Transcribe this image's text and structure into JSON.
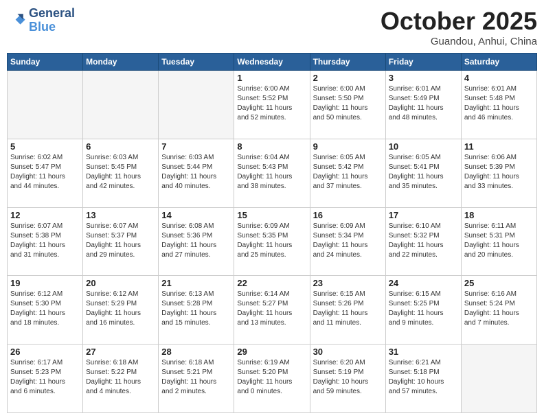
{
  "header": {
    "logo_general": "General",
    "logo_blue": "Blue",
    "month": "October 2025",
    "location": "Guandou, Anhui, China"
  },
  "weekdays": [
    "Sunday",
    "Monday",
    "Tuesday",
    "Wednesday",
    "Thursday",
    "Friday",
    "Saturday"
  ],
  "weeks": [
    [
      {
        "day": "",
        "info": ""
      },
      {
        "day": "",
        "info": ""
      },
      {
        "day": "",
        "info": ""
      },
      {
        "day": "1",
        "info": "Sunrise: 6:00 AM\nSunset: 5:52 PM\nDaylight: 11 hours\nand 52 minutes."
      },
      {
        "day": "2",
        "info": "Sunrise: 6:00 AM\nSunset: 5:50 PM\nDaylight: 11 hours\nand 50 minutes."
      },
      {
        "day": "3",
        "info": "Sunrise: 6:01 AM\nSunset: 5:49 PM\nDaylight: 11 hours\nand 48 minutes."
      },
      {
        "day": "4",
        "info": "Sunrise: 6:01 AM\nSunset: 5:48 PM\nDaylight: 11 hours\nand 46 minutes."
      }
    ],
    [
      {
        "day": "5",
        "info": "Sunrise: 6:02 AM\nSunset: 5:47 PM\nDaylight: 11 hours\nand 44 minutes."
      },
      {
        "day": "6",
        "info": "Sunrise: 6:03 AM\nSunset: 5:45 PM\nDaylight: 11 hours\nand 42 minutes."
      },
      {
        "day": "7",
        "info": "Sunrise: 6:03 AM\nSunset: 5:44 PM\nDaylight: 11 hours\nand 40 minutes."
      },
      {
        "day": "8",
        "info": "Sunrise: 6:04 AM\nSunset: 5:43 PM\nDaylight: 11 hours\nand 38 minutes."
      },
      {
        "day": "9",
        "info": "Sunrise: 6:05 AM\nSunset: 5:42 PM\nDaylight: 11 hours\nand 37 minutes."
      },
      {
        "day": "10",
        "info": "Sunrise: 6:05 AM\nSunset: 5:41 PM\nDaylight: 11 hours\nand 35 minutes."
      },
      {
        "day": "11",
        "info": "Sunrise: 6:06 AM\nSunset: 5:39 PM\nDaylight: 11 hours\nand 33 minutes."
      }
    ],
    [
      {
        "day": "12",
        "info": "Sunrise: 6:07 AM\nSunset: 5:38 PM\nDaylight: 11 hours\nand 31 minutes."
      },
      {
        "day": "13",
        "info": "Sunrise: 6:07 AM\nSunset: 5:37 PM\nDaylight: 11 hours\nand 29 minutes."
      },
      {
        "day": "14",
        "info": "Sunrise: 6:08 AM\nSunset: 5:36 PM\nDaylight: 11 hours\nand 27 minutes."
      },
      {
        "day": "15",
        "info": "Sunrise: 6:09 AM\nSunset: 5:35 PM\nDaylight: 11 hours\nand 25 minutes."
      },
      {
        "day": "16",
        "info": "Sunrise: 6:09 AM\nSunset: 5:34 PM\nDaylight: 11 hours\nand 24 minutes."
      },
      {
        "day": "17",
        "info": "Sunrise: 6:10 AM\nSunset: 5:32 PM\nDaylight: 11 hours\nand 22 minutes."
      },
      {
        "day": "18",
        "info": "Sunrise: 6:11 AM\nSunset: 5:31 PM\nDaylight: 11 hours\nand 20 minutes."
      }
    ],
    [
      {
        "day": "19",
        "info": "Sunrise: 6:12 AM\nSunset: 5:30 PM\nDaylight: 11 hours\nand 18 minutes."
      },
      {
        "day": "20",
        "info": "Sunrise: 6:12 AM\nSunset: 5:29 PM\nDaylight: 11 hours\nand 16 minutes."
      },
      {
        "day": "21",
        "info": "Sunrise: 6:13 AM\nSunset: 5:28 PM\nDaylight: 11 hours\nand 15 minutes."
      },
      {
        "day": "22",
        "info": "Sunrise: 6:14 AM\nSunset: 5:27 PM\nDaylight: 11 hours\nand 13 minutes."
      },
      {
        "day": "23",
        "info": "Sunrise: 6:15 AM\nSunset: 5:26 PM\nDaylight: 11 hours\nand 11 minutes."
      },
      {
        "day": "24",
        "info": "Sunrise: 6:15 AM\nSunset: 5:25 PM\nDaylight: 11 hours\nand 9 minutes."
      },
      {
        "day": "25",
        "info": "Sunrise: 6:16 AM\nSunset: 5:24 PM\nDaylight: 11 hours\nand 7 minutes."
      }
    ],
    [
      {
        "day": "26",
        "info": "Sunrise: 6:17 AM\nSunset: 5:23 PM\nDaylight: 11 hours\nand 6 minutes."
      },
      {
        "day": "27",
        "info": "Sunrise: 6:18 AM\nSunset: 5:22 PM\nDaylight: 11 hours\nand 4 minutes."
      },
      {
        "day": "28",
        "info": "Sunrise: 6:18 AM\nSunset: 5:21 PM\nDaylight: 11 hours\nand 2 minutes."
      },
      {
        "day": "29",
        "info": "Sunrise: 6:19 AM\nSunset: 5:20 PM\nDaylight: 11 hours\nand 0 minutes."
      },
      {
        "day": "30",
        "info": "Sunrise: 6:20 AM\nSunset: 5:19 PM\nDaylight: 10 hours\nand 59 minutes."
      },
      {
        "day": "31",
        "info": "Sunrise: 6:21 AM\nSunset: 5:18 PM\nDaylight: 10 hours\nand 57 minutes."
      },
      {
        "day": "",
        "info": ""
      }
    ]
  ]
}
